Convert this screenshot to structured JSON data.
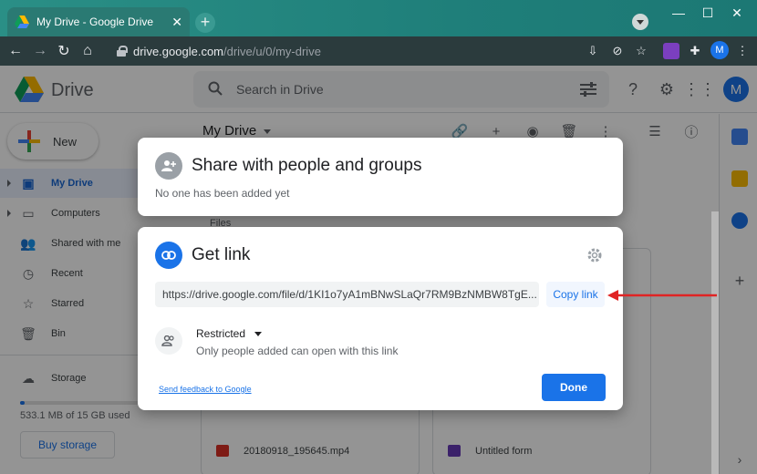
{
  "browser": {
    "tab_title": "My Drive - Google Drive",
    "tab_close": "✕",
    "new_tab": "+",
    "url_host": "drive.google.com",
    "url_path": "/drive/u/0/my-drive",
    "profile_initial": "M",
    "window_buttons": {
      "minimize": "—",
      "maximize": "☐",
      "close": "✕"
    }
  },
  "drive": {
    "app_name": "Drive",
    "search_placeholder": "Search in Drive",
    "avatar_initial": "M",
    "new_label": "New",
    "nav": [
      {
        "label": "My Drive",
        "icon": "drive-icon",
        "active": true
      },
      {
        "label": "Computers",
        "icon": "computer-icon",
        "active": false
      },
      {
        "label": "Shared with me",
        "icon": "people-icon",
        "active": false
      },
      {
        "label": "Recent",
        "icon": "clock-icon",
        "active": false
      },
      {
        "label": "Starred",
        "icon": "star-icon",
        "active": false
      },
      {
        "label": "Bin",
        "icon": "trash-icon",
        "active": false
      }
    ],
    "storage_label": "Storage",
    "storage_used_fraction": 0.035,
    "storage_text": "533.1 MB of 15 GB used",
    "buy_storage": "Buy storage",
    "main_title": "My Drive",
    "files_label": "Files",
    "files": [
      {
        "name": "20180918_195645.mp4",
        "icon_color": "#d93025"
      },
      {
        "name": "Untitled form",
        "icon_color": "#673ab7"
      }
    ]
  },
  "share_dialog": {
    "title": "Share with people and groups",
    "subtitle": "No one has been added yet"
  },
  "link_dialog": {
    "title": "Get link",
    "link": "https://drive.google.com/file/d/1KI1o7yA1mBNwSLaQr7RM9BzNMBW8TgE...",
    "copy_label": "Copy link",
    "access_label": "Restricted",
    "access_desc": "Only people added can open with this link",
    "feedback": "Send feedback to Google",
    "done": "Done"
  },
  "colors": {
    "accent": "#1a73e8",
    "arrow": "#e02424"
  }
}
